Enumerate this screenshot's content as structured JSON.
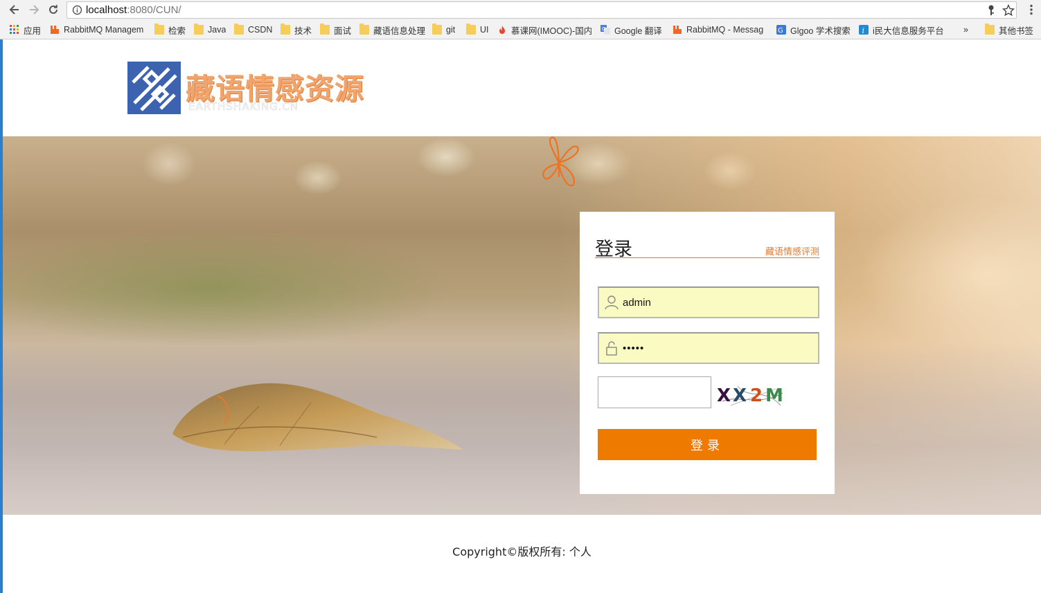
{
  "browser": {
    "url_host": "localhost",
    "url_path": ":8080/CUN/",
    "icons": {
      "back": "arrow-left-icon",
      "forward": "arrow-right-icon",
      "reload": "reload-icon",
      "info": "info-icon",
      "key": "key-icon",
      "star": "star-icon",
      "menu": "menu-dots-icon"
    },
    "bookmarks": [
      {
        "label": "应用",
        "icon": "apps-grid-icon"
      },
      {
        "label": "RabbitMQ Managem",
        "icon": "rabbitmq-icon"
      },
      {
        "label": "检索",
        "icon": "folder-icon"
      },
      {
        "label": "Java",
        "icon": "folder-icon"
      },
      {
        "label": "CSDN",
        "icon": "folder-icon"
      },
      {
        "label": "技术",
        "icon": "folder-icon"
      },
      {
        "label": "面试",
        "icon": "folder-icon"
      },
      {
        "label": "藏语信息处理",
        "icon": "folder-icon"
      },
      {
        "label": "git",
        "icon": "folder-icon"
      },
      {
        "label": "UI",
        "icon": "folder-icon"
      },
      {
        "label": "慕课网(IMOOC)-国内",
        "icon": "fire-icon"
      },
      {
        "label": "Google 翻译",
        "icon": "google-translate-icon"
      },
      {
        "label": "RabbitMQ - Messag",
        "icon": "rabbitmq-icon"
      },
      {
        "label": "Glgoo 学术搜索",
        "icon": "glgoo-icon"
      },
      {
        "label": "i民大信息服务平台",
        "icon": "info-i-icon"
      }
    ],
    "overflow_label": "»",
    "other_bookmarks": "其他书签"
  },
  "page": {
    "logo": {
      "title": "藏语情感资源",
      "subtitle": "EARTHSHAKING.CN"
    },
    "login": {
      "title": "登录",
      "link": "藏语情感评测",
      "username_value": "admin",
      "password_value": "•••••",
      "captcha_value": "",
      "captcha_text": "XX2M",
      "submit_label": "登录"
    },
    "footer": "Copyright©版权所有: 个人"
  },
  "colors": {
    "accent_orange": "#ef7a00",
    "link_orange": "#e2782b",
    "input_fill": "#fafbc2",
    "logo_blue": "#3c62b0"
  }
}
